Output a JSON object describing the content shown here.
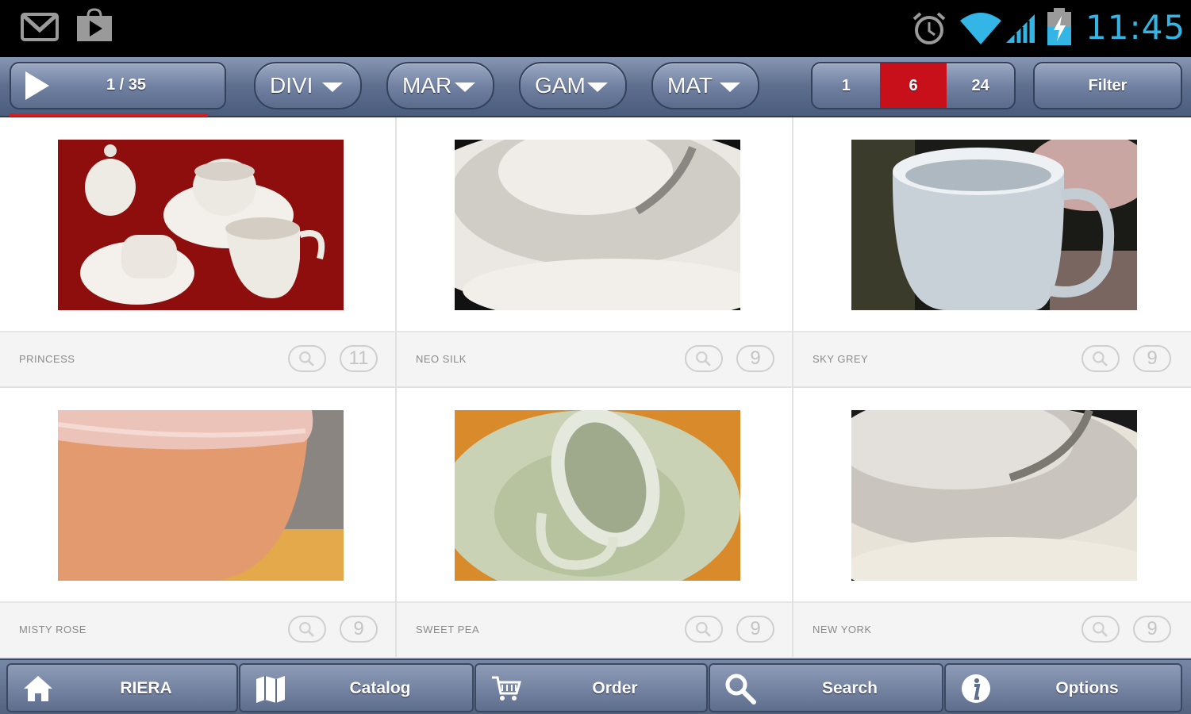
{
  "status_bar": {
    "icons": [
      "gmail-icon",
      "play-store-icon",
      "alarm-icon",
      "wifi-icon",
      "signal-icon",
      "battery-charging-icon"
    ],
    "time": "11:45"
  },
  "toolbar": {
    "play_icon": "play-icon",
    "counter": "1 / 35",
    "dropdowns": [
      {
        "label": "DIVI"
      },
      {
        "label": "MAR"
      },
      {
        "label": "GAM"
      },
      {
        "label": "MAT"
      }
    ],
    "per_page": {
      "options": [
        "1",
        "6",
        "24"
      ],
      "selected": "6"
    },
    "filter_label": "Filter",
    "accent_color": "#c8101a"
  },
  "products": [
    {
      "name": "PRINCESS",
      "count": "11"
    },
    {
      "name": "NEO SILK",
      "count": "9"
    },
    {
      "name": "SKY GREY",
      "count": "9"
    },
    {
      "name": "MISTY ROSE",
      "count": "9"
    },
    {
      "name": "SWEET PEA",
      "count": "9"
    },
    {
      "name": "NEW YORK",
      "count": "9"
    }
  ],
  "bottom_nav": [
    {
      "icon": "home-icon",
      "label": "RIERA"
    },
    {
      "icon": "map-icon",
      "label": "Catalog"
    },
    {
      "icon": "cart-icon",
      "label": "Order"
    },
    {
      "icon": "search-icon",
      "label": "Search"
    },
    {
      "icon": "info-icon",
      "label": "Options"
    }
  ]
}
